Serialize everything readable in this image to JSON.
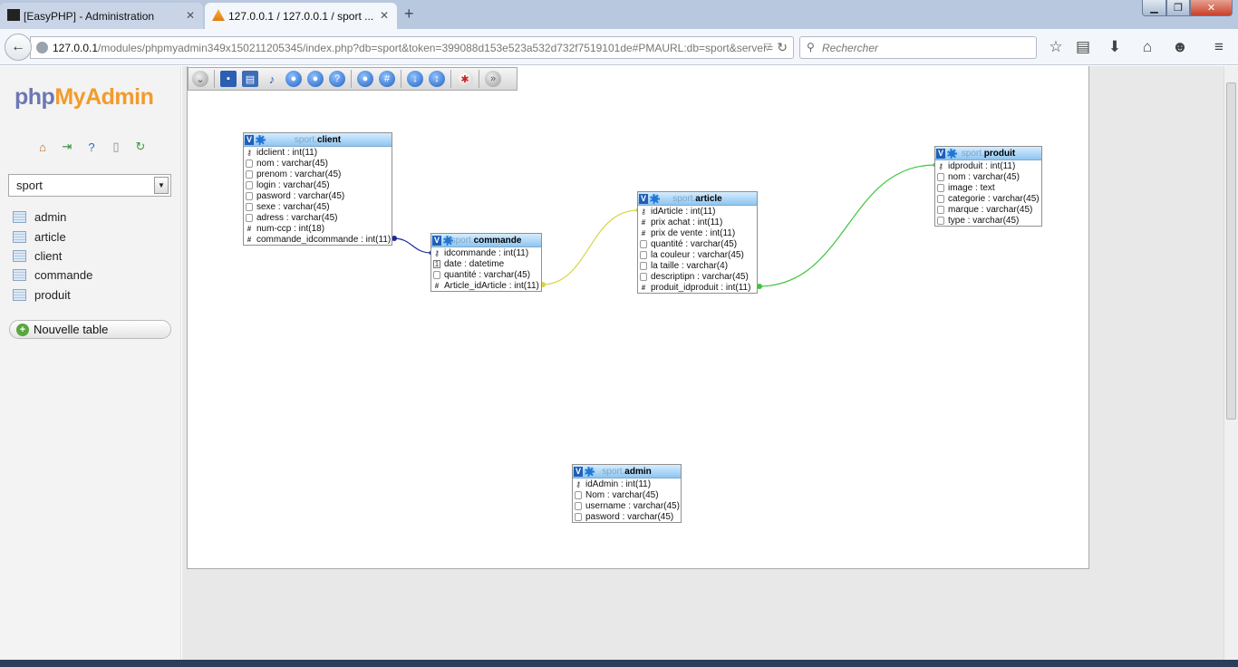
{
  "browser": {
    "tabs": [
      {
        "title": "[EasyPHP] - Administration",
        "active": false
      },
      {
        "title": "127.0.0.1 / 127.0.0.1 / sport ...",
        "active": true
      }
    ],
    "url_host": "127.0.0.1",
    "url_path": "/modules/phpmyadmin349x150211205345/index.php?db=sport&token=399088d153e523a532d732f7519101de#PMAURL:db=sport&server=",
    "search_placeholder": "Rechercher"
  },
  "sidebar": {
    "logo_php": "php",
    "logo_my": "My",
    "logo_admin": "Admin",
    "selected_db": "sport",
    "tables": [
      "admin",
      "article",
      "client",
      "commande",
      "produit"
    ],
    "new_table_label": "Nouvelle table"
  },
  "designer": {
    "db_prefix": "sport.",
    "tables": {
      "client": {
        "name": "client",
        "columns": [
          {
            "icon": "key",
            "label": "idclient : int(11)"
          },
          {
            "icon": "txt",
            "label": "nom : varchar(45)"
          },
          {
            "icon": "txt",
            "label": "prenom : varchar(45)"
          },
          {
            "icon": "txt",
            "label": "login : varchar(45)"
          },
          {
            "icon": "txt",
            "label": "pasword : varchar(45)"
          },
          {
            "icon": "txt",
            "label": "sexe : varchar(45)"
          },
          {
            "icon": "txt",
            "label": "adress : varchar(45)"
          },
          {
            "icon": "num",
            "label": "num-ccp : int(18)"
          },
          {
            "icon": "num",
            "label": "commande_idcommande : int(11)"
          }
        ]
      },
      "commande": {
        "name": "commande",
        "columns": [
          {
            "icon": "key",
            "label": "idcommande : int(11)"
          },
          {
            "icon": "date",
            "label": "date : datetime"
          },
          {
            "icon": "txt",
            "label": "quantité : varchar(45)"
          },
          {
            "icon": "num",
            "label": "Article_idArticle : int(11)"
          }
        ]
      },
      "article": {
        "name": "article",
        "columns": [
          {
            "icon": "key",
            "label": "idArticle : int(11)"
          },
          {
            "icon": "num",
            "label": "prix achat : int(11)"
          },
          {
            "icon": "num",
            "label": "prix de vente : int(11)"
          },
          {
            "icon": "txt",
            "label": "quantité : varchar(45)"
          },
          {
            "icon": "txt",
            "label": "la couleur : varchar(45)"
          },
          {
            "icon": "txt",
            "label": "la taille : varchar(4)"
          },
          {
            "icon": "txt",
            "label": "descriptipn : varchar(45)"
          },
          {
            "icon": "num",
            "label": "produit_idproduit : int(11)"
          }
        ]
      },
      "produit": {
        "name": "produit",
        "columns": [
          {
            "icon": "key",
            "label": "idproduit : int(11)"
          },
          {
            "icon": "txt",
            "label": "nom : varchar(45)"
          },
          {
            "icon": "txt",
            "label": "image : text"
          },
          {
            "icon": "txt",
            "label": "categorie : varchar(45)"
          },
          {
            "icon": "txt",
            "label": "marque : varchar(45)"
          },
          {
            "icon": "txt",
            "label": "type : varchar(45)"
          }
        ]
      },
      "admin": {
        "name": "admin",
        "columns": [
          {
            "icon": "key",
            "label": "idAdmin : int(11)"
          },
          {
            "icon": "txt",
            "label": "Nom : varchar(45)"
          },
          {
            "icon": "txt",
            "label": "username : varchar(45)"
          },
          {
            "icon": "txt",
            "label": "pasword : varchar(45)"
          }
        ]
      }
    },
    "relation_colors": {
      "client_commande": "#1a2a9a",
      "commande_article": "#d8d44a",
      "article_produit": "#3cc43c"
    }
  }
}
